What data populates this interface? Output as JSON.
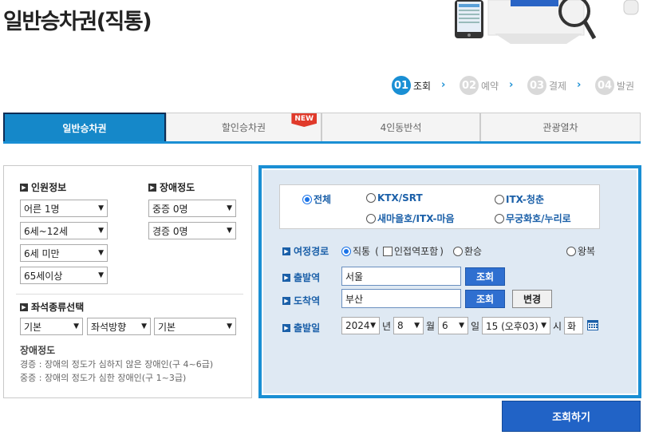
{
  "page_title": "일반승차권(직통)",
  "steps": [
    {
      "num": "01",
      "label": "조회"
    },
    {
      "num": "02",
      "label": "예약"
    },
    {
      "num": "03",
      "label": "결제"
    },
    {
      "num": "04",
      "label": "발권"
    }
  ],
  "step_arrow": "›",
  "tabs": [
    {
      "label": "일반승차권"
    },
    {
      "label": "할인승차권",
      "badge": "NEW"
    },
    {
      "label": "4인동반석"
    },
    {
      "label": "관광열차"
    }
  ],
  "passengers": {
    "title": "인원정보",
    "selects": [
      "어른 1명",
      "6세~12세",
      "6세 미만",
      "65세이상"
    ]
  },
  "disability": {
    "title": "장애정도",
    "selects": [
      "중증 0명",
      "경증 0명"
    ]
  },
  "seat_type": {
    "title": "좌석종류선택",
    "selects": [
      "기본",
      "좌석방향",
      "기본"
    ]
  },
  "disability_note": {
    "title": "장애정도",
    "lines": [
      "경증 : 장애의 정도가 심하지 않은 장애인(구 4~6급)",
      "중증 : 장애의 정도가 심한 장애인(구 1~3급)"
    ]
  },
  "train_types": [
    "전체",
    "KTX/SRT",
    "ITX-청춘",
    "새마을호/ITX-마음",
    "무궁화호/누리로"
  ],
  "route": {
    "label": "여정경로",
    "options": [
      "직통",
      "인접역포함",
      "환승",
      "왕복"
    ]
  },
  "departure": {
    "label": "출발역",
    "value": "서울",
    "btn": "조회"
  },
  "arrival": {
    "label": "도착역",
    "value": "부산",
    "btn": "조회",
    "swap": "변경"
  },
  "date": {
    "label": "출발일",
    "year": "2024",
    "year_unit": "년",
    "month": "8",
    "month_unit": "월",
    "day": "6",
    "day_unit": "일",
    "hour": "15 (오후03)",
    "hour_unit": "시",
    "weekday": "화"
  },
  "search_button": "조회하기",
  "colors": {
    "accent": "#1a8fd4",
    "button": "#2163c6",
    "panel_bg": "#dfe9f3"
  }
}
